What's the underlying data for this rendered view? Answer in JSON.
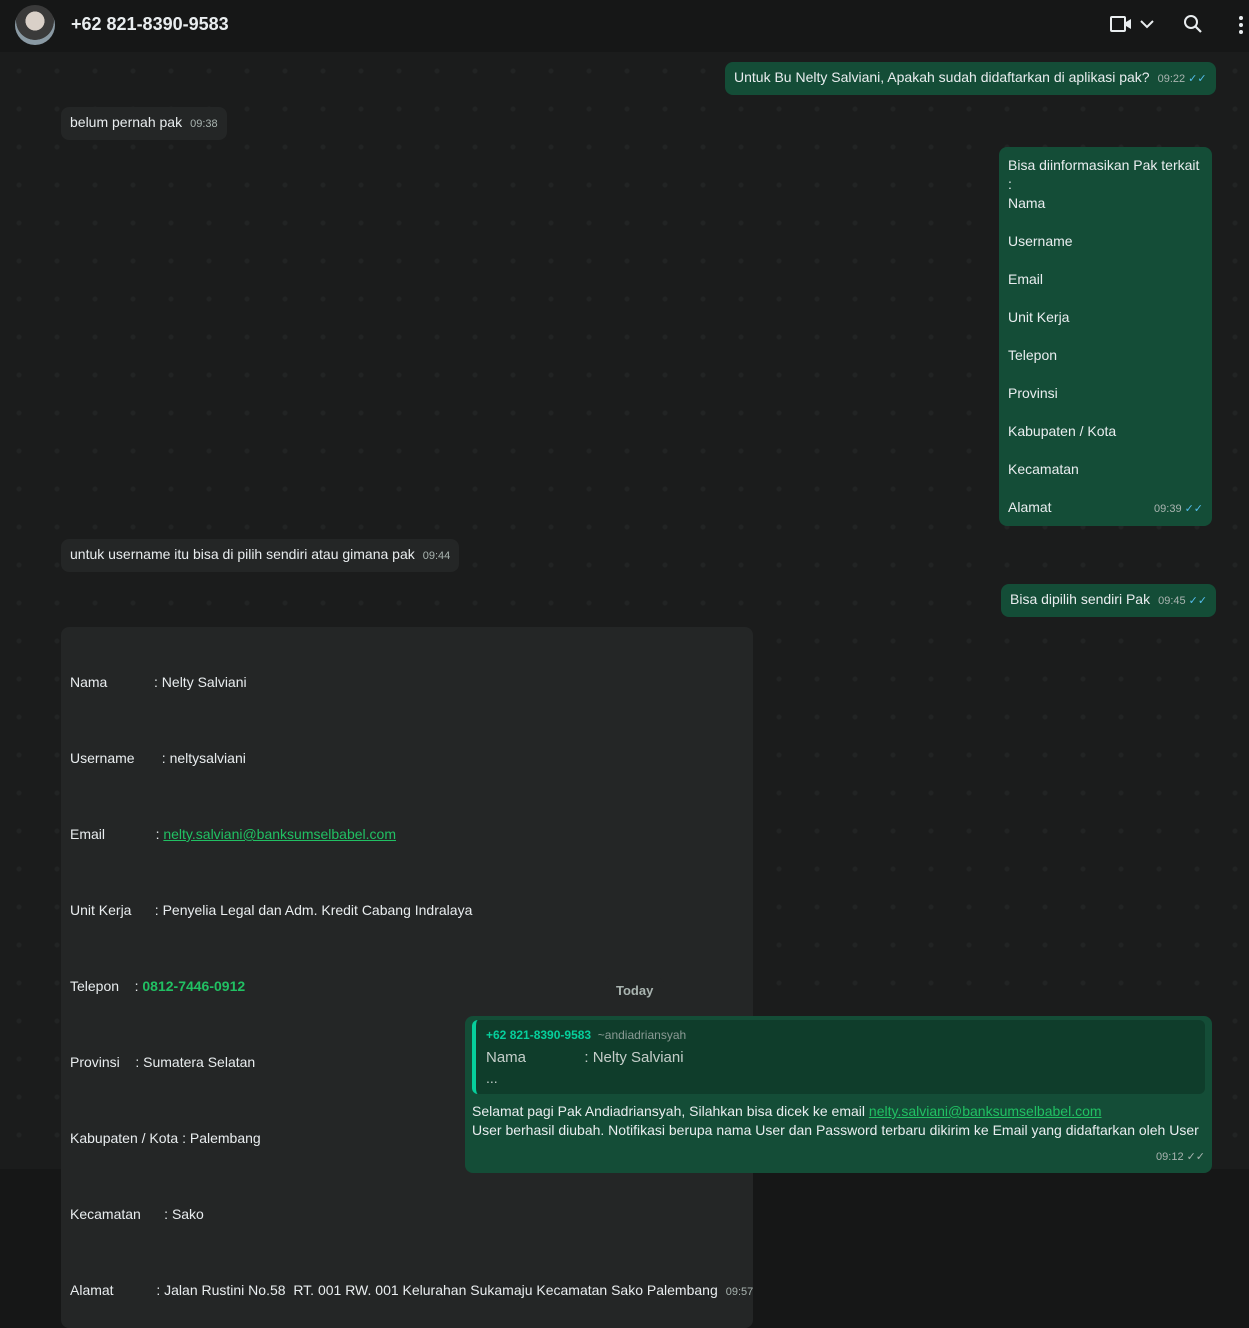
{
  "header": {
    "title": "+62 821-8390-9583",
    "icons": [
      "video-call-icon",
      "chevron-down-icon",
      "search-icon",
      "more-menu-icon"
    ]
  },
  "messages": {
    "m1": {
      "text": "Untuk Bu Nelty Salviani, Apakah sudah didaftarkan di aplikasi pak?",
      "time": "09:22"
    },
    "m2": {
      "text": "belum pernah pak",
      "time": "09:38"
    },
    "m3": {
      "lines": [
        "Bisa diinformasikan Pak terkait :",
        "Nama",
        "Username",
        "Email",
        "Unit Kerja",
        "Telepon",
        "Provinsi",
        "Kabupaten / Kota",
        "Kecamatan",
        "Alamat"
      ],
      "time": "09:39"
    },
    "m4": {
      "text": "untuk username itu bisa di pilih sendiri atau gimana pak",
      "time": "09:44"
    },
    "m5": {
      "text": "Bisa dipilih sendiri Pak",
      "time": "09:45"
    },
    "m6": {
      "nama": "Nama            : Nelty Salviani",
      "username": "Username       : neltysalviani",
      "email_label": "Email             : ",
      "email": "nelty.salviani@banksumselbabel.com",
      "unit": "Unit Kerja      : Penyelia Legal dan Adm. Kredit Cabang Indralaya",
      "telepon_label": "Telepon    : ",
      "telepon": "0812-7446-0912",
      "provinsi": "Provinsi    : Sumatera Selatan",
      "kabupaten": "Kabupaten / Kota : Palembang",
      "kecamatan": "Kecamatan      : Sako",
      "alamat": "Alamat           : Jalan Rustini No.58  RT. 001 RW. 001 Kelurahan Sukamaju Kecamatan Sako Palembang",
      "time": "09:57"
    },
    "divider": "Today",
    "m7": {
      "quote_sender": "+62 821-8390-9583",
      "quote_name": "~andiadriansyah",
      "quote_line": "Nama              : Nelty Salviani",
      "quote_more": "...",
      "text1": "Selamat pagi Pak Andiadriansyah, Silahkan bisa dicek ke email ",
      "email": "nelty.salviani@banksumselbabel.com",
      "text2": "User berhasil diubah. Notifikasi berupa nama User dan Password terbaru dikirim ke Email yang didaftarkan oleh User",
      "time": "09:12"
    }
  }
}
